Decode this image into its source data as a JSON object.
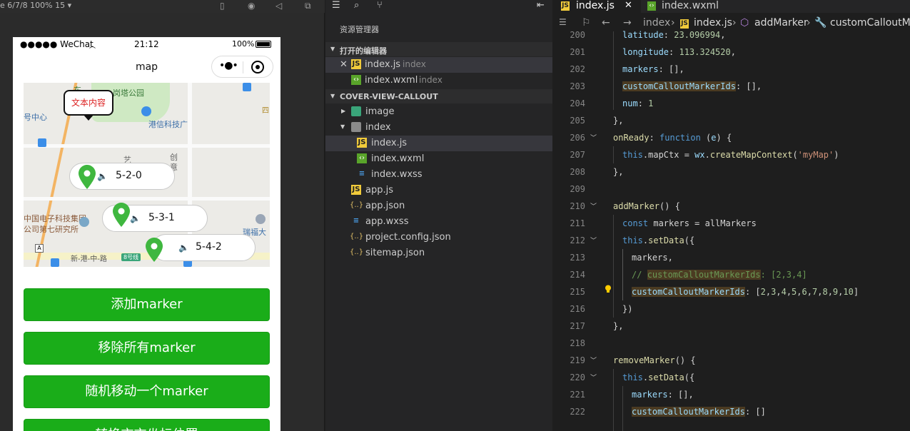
{
  "simulator": {
    "device_meta": "e 6/7/8 100% 15 ▾",
    "status": {
      "signal": "●●●●● WeChat",
      "time": "21:12",
      "battery": "100%"
    },
    "nav": {
      "title": "map"
    },
    "map": {
      "bubble_text": "文本内容",
      "labels": [
        "东",
        "岗塔公园",
        "港信科技广",
        "号中心",
        "艺",
        "创",
        "意",
        "中国电子科技集团",
        "公司第七研究所",
        "瑞福大",
        "四",
        "新-港-中-路",
        "8号线"
      ],
      "callouts": [
        "5-2-0",
        "5-3-1",
        "5-4-2"
      ],
      "speaker_glyph": "🔈"
    },
    "buttons": [
      "添加marker",
      "移除所有marker",
      "随机移动一个marker",
      "转换市市坐标位置"
    ]
  },
  "explorer": {
    "title": "资源管理器",
    "open_editors_label": "打开的编辑器",
    "open_editors": [
      {
        "close": "✕",
        "name": "index.js",
        "hint": "index"
      },
      {
        "name": "index.wxml",
        "hint": "index"
      }
    ],
    "project_label": "COVER-VIEW-CALLOUT",
    "tree": [
      {
        "name": "image"
      },
      {
        "name": "index"
      },
      {
        "name": "index.js"
      },
      {
        "name": "index.wxml"
      },
      {
        "name": "index.wxss"
      },
      {
        "name": "app.js"
      },
      {
        "name": "app.json"
      },
      {
        "name": "app.wxss"
      },
      {
        "name": "project.config.json"
      },
      {
        "name": "sitemap.json"
      }
    ]
  },
  "editor": {
    "tabs": [
      {
        "name": "index.js"
      },
      {
        "name": "index.wxml"
      }
    ],
    "tab_close": "✕",
    "breadcrumb": [
      "index",
      "index.js",
      "addMarker",
      "customCalloutMark"
    ],
    "breadcrumb_sep": "›",
    "line_numbers": [
      "200",
      "201",
      "202",
      "203",
      "204",
      "205",
      "206",
      "207",
      "208",
      "209",
      "210",
      "211",
      "212",
      "213",
      "214",
      "215",
      "216",
      "217",
      "218",
      "219",
      "220",
      "221",
      "222"
    ],
    "code": {
      "l200": [
        "latitude",
        ": ",
        "23.096994",
        ","
      ],
      "l201": [
        "longitude",
        ": ",
        "113.324520",
        ","
      ],
      "l202": [
        "markers",
        ": [],"
      ],
      "l203": [
        "customCalloutMarkerIds",
        ": [],"
      ],
      "l204": [
        "num",
        ": ",
        "1"
      ],
      "l205": [
        "},"
      ],
      "l206": [
        "onReady",
        ": ",
        "function",
        " (",
        "e",
        ") {"
      ],
      "l207": [
        "this",
        ".mapCtx = ",
        "wx",
        ".",
        "createMapContext",
        "(",
        "'myMap'",
        ")"
      ],
      "l208": [
        "},"
      ],
      "l210": [
        "addMarker",
        "() {"
      ],
      "l211": [
        "const",
        " markers = ",
        "allMarkers"
      ],
      "l212": [
        "this",
        ".",
        "setData",
        "({"
      ],
      "l213": [
        "markers",
        ","
      ],
      "l214": [
        "// ",
        "customCalloutMarkerIds",
        ": [2,3,4]"
      ],
      "l215": [
        "customCalloutMarkerIds",
        ": [",
        "2",
        ",",
        "3",
        ",",
        "4",
        ",",
        "5",
        ",",
        "6",
        ",",
        "7",
        ",",
        "8",
        ",",
        "9",
        ",",
        "10",
        "]"
      ],
      "l216": [
        "})"
      ],
      "l217": [
        "},"
      ],
      "l219": [
        "removeMarker",
        "() {"
      ],
      "l220": [
        "this",
        ".",
        "setData",
        "({"
      ],
      "l221": [
        "markers",
        ": [],"
      ],
      "l222": [
        "customCalloutMarkerIds",
        ": []"
      ]
    }
  }
}
